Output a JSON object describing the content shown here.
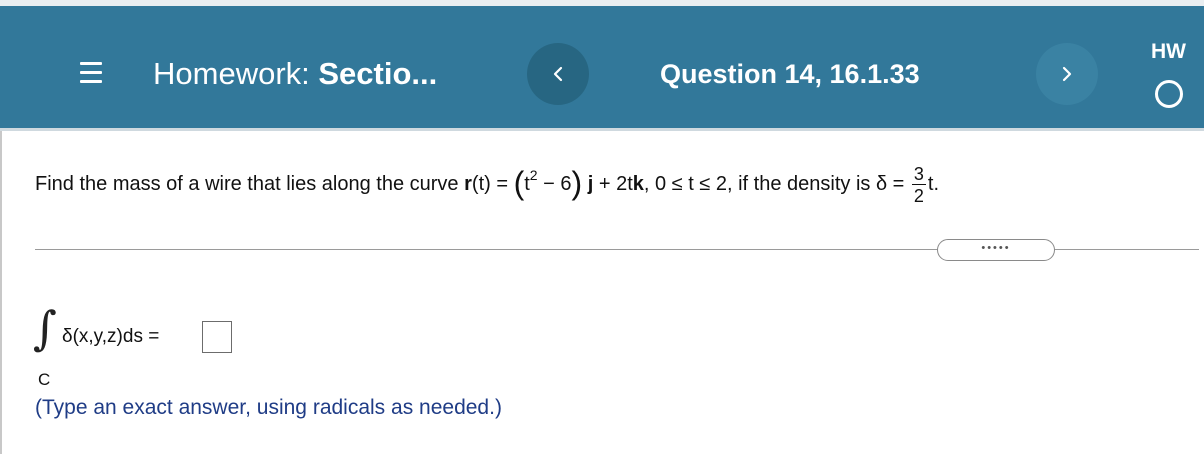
{
  "header": {
    "title_prefix": "Homework: ",
    "title_bold": "Sectio...",
    "question_label": "Question 14, 16.1.33",
    "hw_label": "HW"
  },
  "question": {
    "segments": [
      {
        "t": "Find the mass of a wire that lies along the curve ",
        "s": ""
      },
      {
        "t": "r",
        "s": "bold"
      },
      {
        "t": "(t) = ",
        "s": ""
      },
      {
        "t": "(",
        "s": "paren"
      },
      {
        "t": "t",
        "s": ""
      },
      {
        "t": "2",
        "s": "sup"
      },
      {
        "t": " − 6",
        "s": ""
      },
      {
        "t": ")",
        "s": "paren"
      },
      {
        "t": " ",
        "s": ""
      },
      {
        "t": "j",
        "s": "bold"
      },
      {
        "t": " + 2t",
        "s": ""
      },
      {
        "t": "k",
        "s": "bold"
      },
      {
        "t": ", 0 ≤ t ≤ 2, if the density is δ = ",
        "s": ""
      }
    ],
    "density_num": "3",
    "density_den": "2",
    "density_suffix": "t."
  },
  "more_indicator": "•••••",
  "answer": {
    "integral_sign": "∫",
    "integrand": "δ(x,y,z)ds =",
    "lower_limit": "C",
    "value": ""
  },
  "hint": "(Type an exact answer, using radicals as needed.)",
  "colors": {
    "header_bg": "#32789a",
    "prev_button_bg": "#276682",
    "next_button_bg": "#3a82a3",
    "hint_text": "#1f3c86"
  }
}
